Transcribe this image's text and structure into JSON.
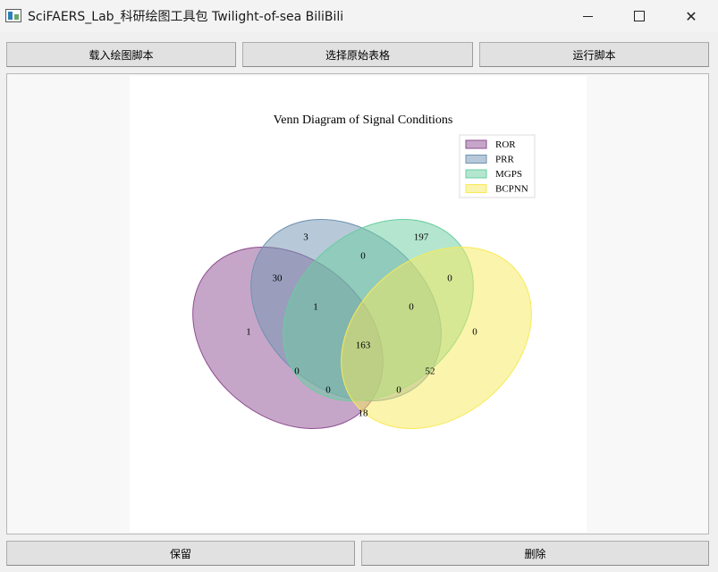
{
  "window": {
    "title": "SciFAERS_Lab_科研绘图工具包 Twilight-of-sea BiliBili",
    "minimize_glyph": "",
    "maximize_glyph": "",
    "close_glyph": "✕"
  },
  "toolbar": {
    "load_script": "载入绘图脚本",
    "select_table": "选择原始表格",
    "run_script": "运行脚本"
  },
  "footer": {
    "keep": "保留",
    "delete": "删除"
  },
  "chart_data": {
    "type": "venn",
    "title": "Venn Diagram of Signal Conditions",
    "legend_placement": "top-right",
    "sets": [
      {
        "name": "ROR",
        "color": "#8e4d91"
      },
      {
        "name": "PRR",
        "color": "#6f93b1"
      },
      {
        "name": "MGPS",
        "color": "#69cda0"
      },
      {
        "name": "BCPNN",
        "color": "#f8ea59"
      }
    ],
    "regions": [
      {
        "sets": [
          "ROR"
        ],
        "value": "1"
      },
      {
        "sets": [
          "PRR"
        ],
        "value": "3"
      },
      {
        "sets": [
          "MGPS"
        ],
        "value": "197"
      },
      {
        "sets": [
          "BCPNN"
        ],
        "value": "0"
      },
      {
        "sets": [
          "ROR",
          "PRR"
        ],
        "value": "30"
      },
      {
        "sets": [
          "PRR",
          "MGPS"
        ],
        "value": "0"
      },
      {
        "sets": [
          "MGPS",
          "BCPNN"
        ],
        "value": "0"
      },
      {
        "sets": [
          "ROR",
          "BCPNN"
        ],
        "value": "18"
      },
      {
        "sets": [
          "ROR",
          "PRR",
          "MGPS"
        ],
        "value": "1"
      },
      {
        "sets": [
          "PRR",
          "MGPS",
          "BCPNN"
        ],
        "value": "0"
      },
      {
        "sets": [
          "ROR",
          "PRR",
          "BCPNN"
        ],
        "value": "0"
      },
      {
        "sets": [
          "ROR",
          "MGPS",
          "BCPNN"
        ],
        "value": "0"
      },
      {
        "sets": [
          "ROR",
          "MGPS"
        ],
        "value": "0"
      },
      {
        "sets": [
          "PRR",
          "BCPNN"
        ],
        "value": "52"
      },
      {
        "sets": [
          "ROR",
          "PRR",
          "MGPS",
          "BCPNN"
        ],
        "value": "163"
      }
    ]
  }
}
